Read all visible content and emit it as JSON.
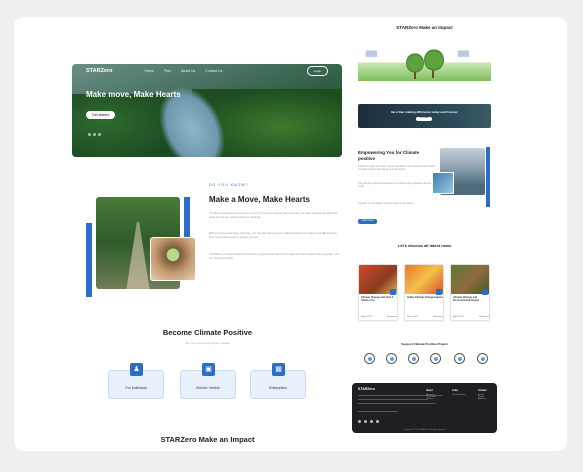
{
  "hero": {
    "logo": "STARZero",
    "nav": [
      "Home",
      "Plan",
      "About Us",
      "Contact Us"
    ],
    "login": "Login",
    "headline": "Make move, Make Hearts",
    "cta": "Get started"
  },
  "about": {
    "eyebrow": "DO YOU KNOW?",
    "title": "Make a Move, Make Hearts",
    "paragraphs": [
      "Your life is fast-paced and there is so much you want to achieve. But every day you make choices that affect the world around you and the planet we all share.",
      "With just three small steps each day, you can start reducing your carbon footprint and make a real difference for future generations and the people you love.",
      "STARZero is a simple platform that helps everyone understand their impact and take positive action together. Join our community today."
    ]
  },
  "climate_positive": {
    "title": "Become Climate Positive",
    "subtitle": "Join us in becoming climate positive",
    "options": [
      {
        "label": "For Individual",
        "icon": "person-icon"
      },
      {
        "label": "Electric Vehicle",
        "icon": "car-icon"
      },
      {
        "label": "Enterprises",
        "icon": "building-icon"
      }
    ]
  },
  "impact_heading": "STARZero Make an Impact",
  "right": {
    "impact_title": "STARZero Make an Impact",
    "banner_title": "Be a Star making difference today and Forever",
    "banner_button": "Join Now",
    "empower_title": "Empowering You for Climate positive",
    "empower_paragraphs": [
      "STARZero helps you track, reduce and offset your emissions with simple everyday actions that add up to a big impact.",
      "Our projects support reforestation and clean energy initiatives around the world.",
      "Together we can build a positive future for the planet."
    ],
    "empower_button": "Learn more",
    "news_title": "Let's discuss all latest news",
    "news": [
      {
        "title": "Climate Change and How it Affects You",
        "date": "March 2023",
        "more": "Read more"
      },
      {
        "title": "Indias Climate Change Impact",
        "date": "March 2023",
        "more": "Read more"
      },
      {
        "title": "Climate Change and Environmental Impact",
        "date": "March 2023",
        "more": "Read more"
      }
    ],
    "support_title": "Support Climate Positive Project",
    "footer": {
      "logo": "STARZero",
      "columns": [
        {
          "heading": "About",
          "items": [
            "About Us",
            "Our Plans",
            "Contact"
          ]
        },
        {
          "heading": "Links",
          "items": [
            "Privacy Policy"
          ]
        },
        {
          "heading": "Contact",
          "items": [
            "Email",
            "Phone",
            "Address"
          ]
        }
      ],
      "copyright": "Copyright © 2023 STARZero. All rights reserved."
    }
  }
}
